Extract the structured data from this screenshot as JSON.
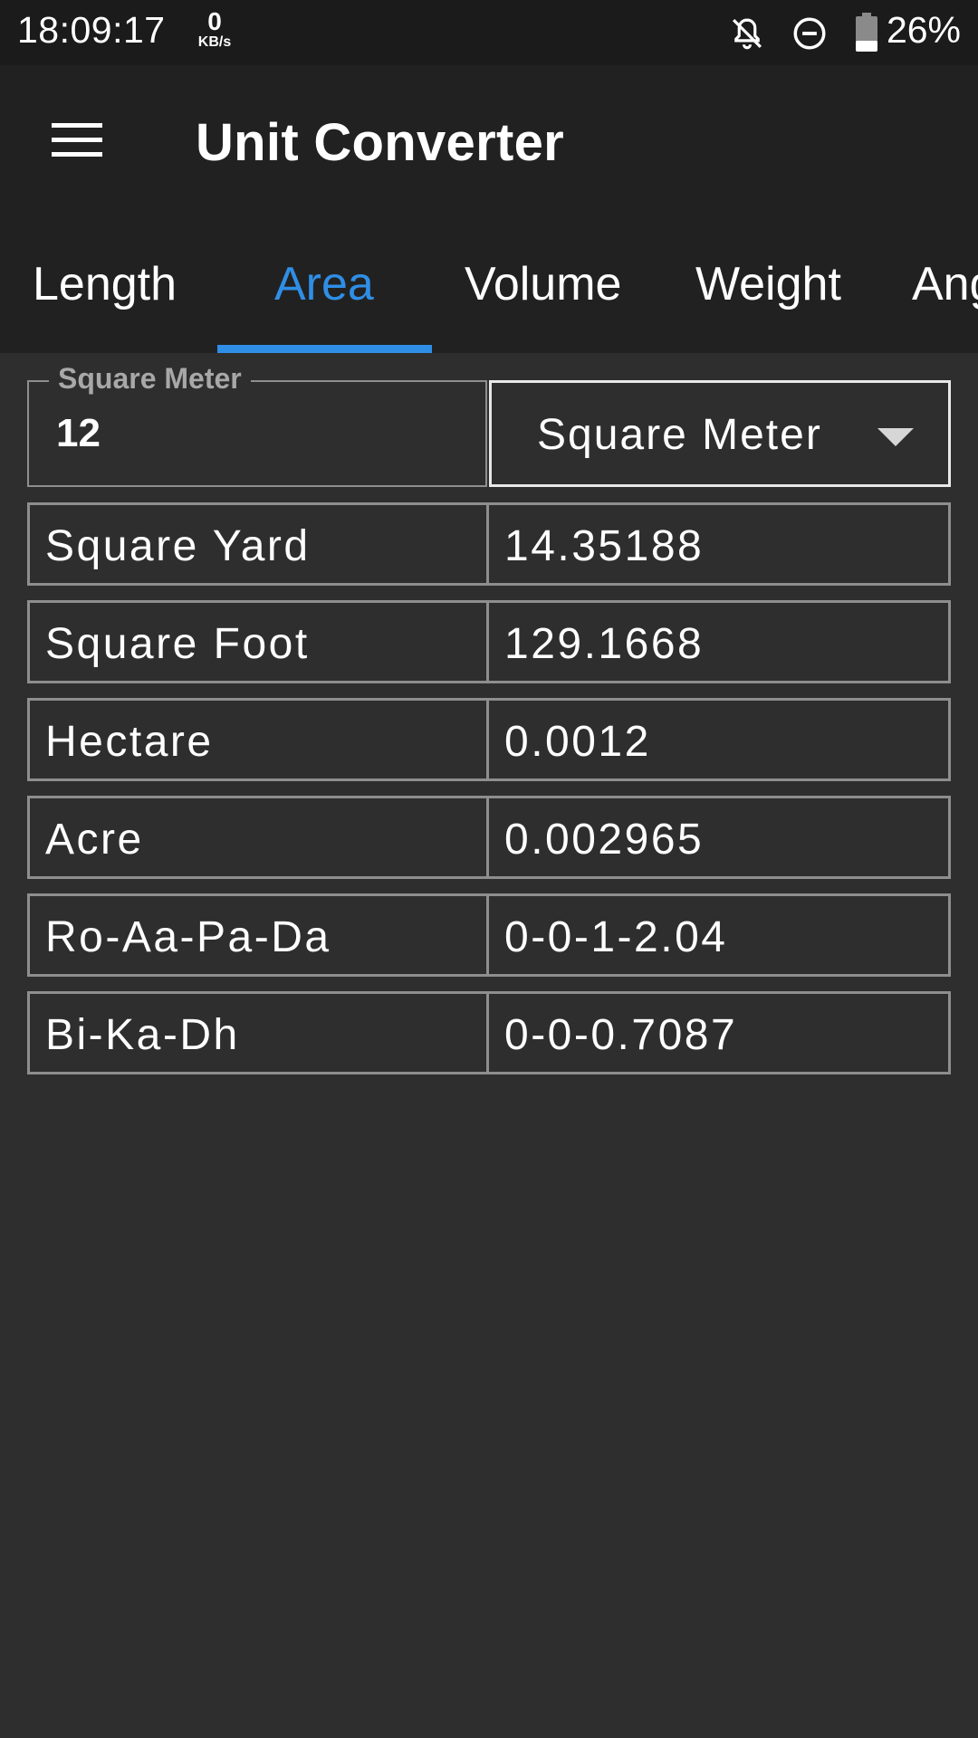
{
  "status_bar": {
    "time": "18:09:17",
    "net_speed_value": "0",
    "net_speed_unit": "KB/s",
    "battery_percent": "26%",
    "icons": [
      "notifications-off-icon",
      "do-not-disturb-icon",
      "battery-icon"
    ]
  },
  "app_bar": {
    "title": "Unit Converter",
    "menu_icon": "hamburger-menu-icon"
  },
  "tabs": [
    {
      "label": "Length",
      "active": false
    },
    {
      "label": "Area",
      "active": true
    },
    {
      "label": "Volume",
      "active": false
    },
    {
      "label": "Weight",
      "active": false
    },
    {
      "label": "Ang",
      "active": false
    }
  ],
  "accent_color": "#2f8ee6",
  "converter": {
    "input_label": "Square Meter",
    "input_value": "12",
    "selected_unit": "Square Meter",
    "dropdown_icon": "dropdown-arrow-icon"
  },
  "results": [
    {
      "unit": "Square Yard",
      "value": "14.35188"
    },
    {
      "unit": "Square Foot",
      "value": "129.1668"
    },
    {
      "unit": "Hectare",
      "value": "0.0012"
    },
    {
      "unit": "Acre",
      "value": "0.002965"
    },
    {
      "unit": "Ro-Aa-Pa-Da",
      "value": "0-0-1-2.04"
    },
    {
      "unit": "Bi-Ka-Dh",
      "value": "0-0-0.7087"
    }
  ]
}
